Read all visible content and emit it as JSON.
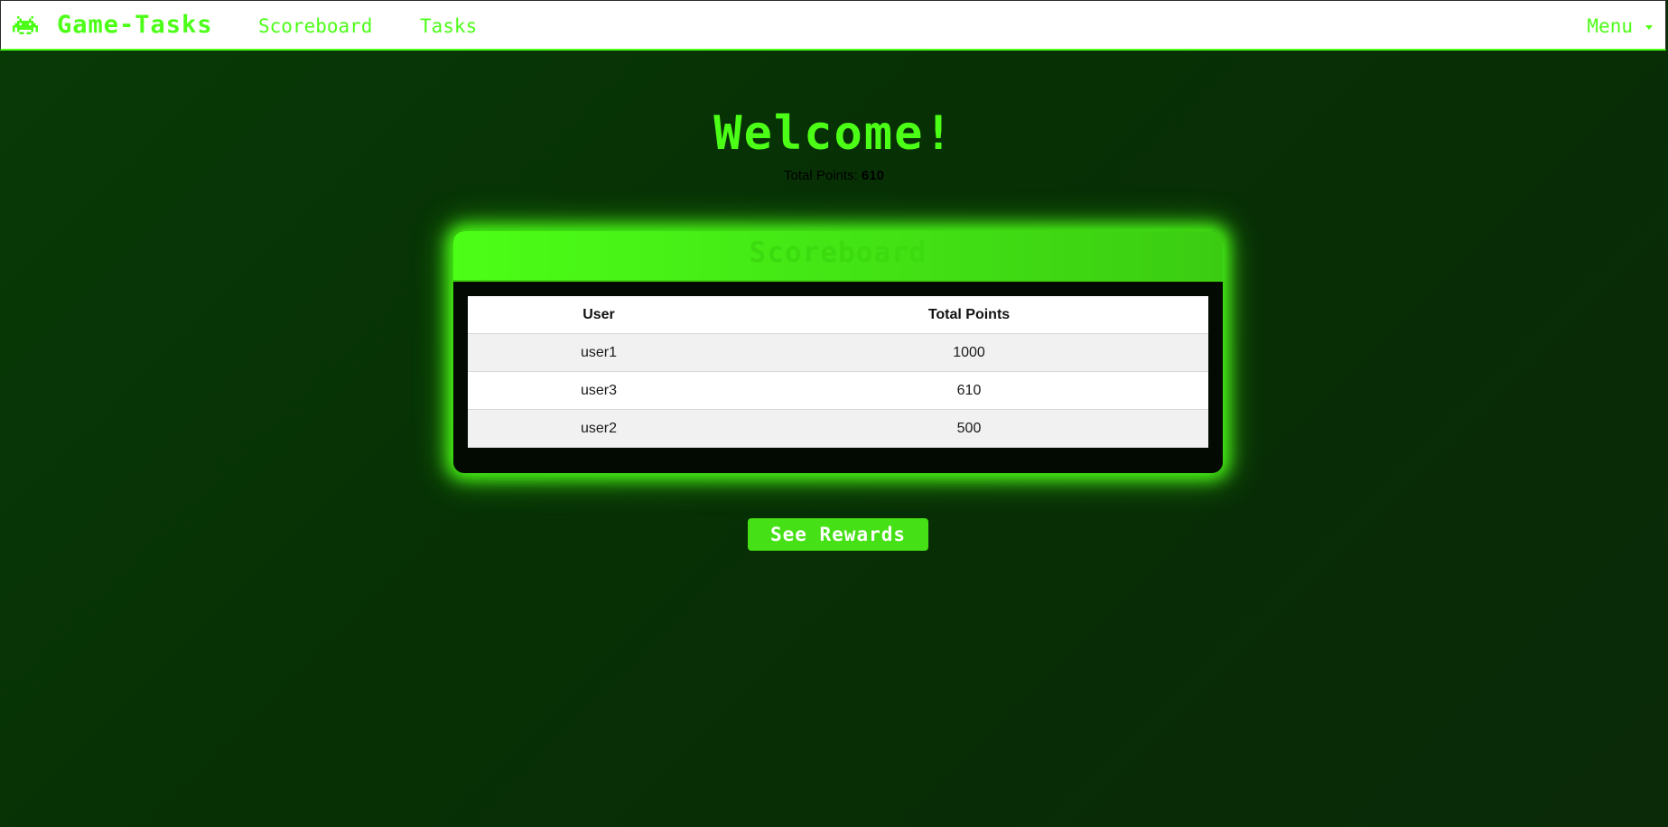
{
  "navbar": {
    "brand": "Game-Tasks",
    "links": [
      {
        "label": "Scoreboard"
      },
      {
        "label": "Tasks"
      }
    ],
    "menu_label": "Menu",
    "logo_icon": "space-invader-icon"
  },
  "main": {
    "welcome": "Welcome!",
    "total_points_label": "Total Points:",
    "total_points_value": "610"
  },
  "scoreboard": {
    "title": "Scoreboard",
    "columns": [
      "User",
      "Total Points"
    ],
    "rows": [
      {
        "user": "user1",
        "points": "1000"
      },
      {
        "user": "user3",
        "points": "610"
      },
      {
        "user": "user2",
        "points": "500"
      }
    ]
  },
  "actions": {
    "rewards_label": "See Rewards"
  },
  "colors": {
    "accent": "#4cff17",
    "background": "#073005",
    "card_body": "#020a02"
  }
}
